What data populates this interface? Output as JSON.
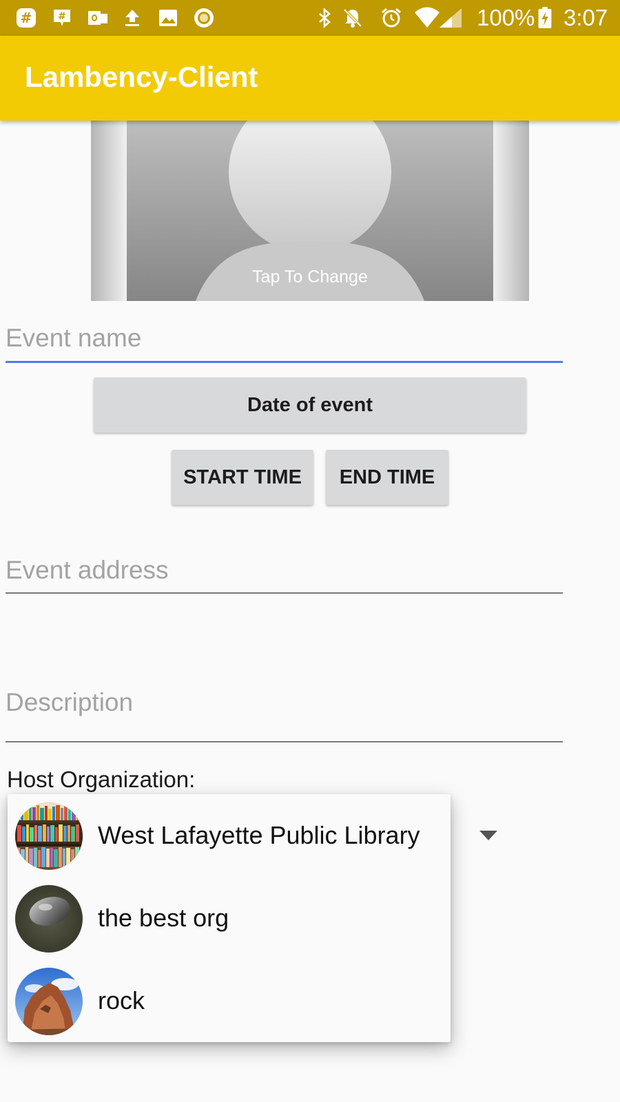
{
  "status_bar": {
    "battery": "100%",
    "time": "3:07",
    "icons": [
      "slack-icon",
      "chat-icon",
      "outlook-icon",
      "upload-icon",
      "image-icon",
      "record-icon",
      "bluetooth-icon",
      "mute-icon",
      "alarm-icon",
      "wifi-icon",
      "signal-icon",
      "battery-charging-icon"
    ]
  },
  "app_bar": {
    "title": "Lambency-Client"
  },
  "event_image": {
    "tap_label": "Tap To Change"
  },
  "form": {
    "event_name_placeholder": "Event name",
    "date_button": "Date of event",
    "start_time_button": "START TIME",
    "end_time_button": "END TIME",
    "event_address_placeholder": "Event address",
    "description_placeholder": "Description",
    "host_org_label": "Host Organization:"
  },
  "org_dropdown": {
    "options": [
      {
        "name": "West Lafayette Public Library",
        "avatar": "bookshelf-photo"
      },
      {
        "name": "the best org",
        "avatar": "mouse-photo"
      },
      {
        "name": "rock",
        "avatar": "rock-photo"
      }
    ]
  },
  "colors": {
    "status_bar": "#bf9a00",
    "app_bar": "#f2cb05",
    "focus_underline": "#4a80e8",
    "button_bg": "#d8d9da"
  }
}
